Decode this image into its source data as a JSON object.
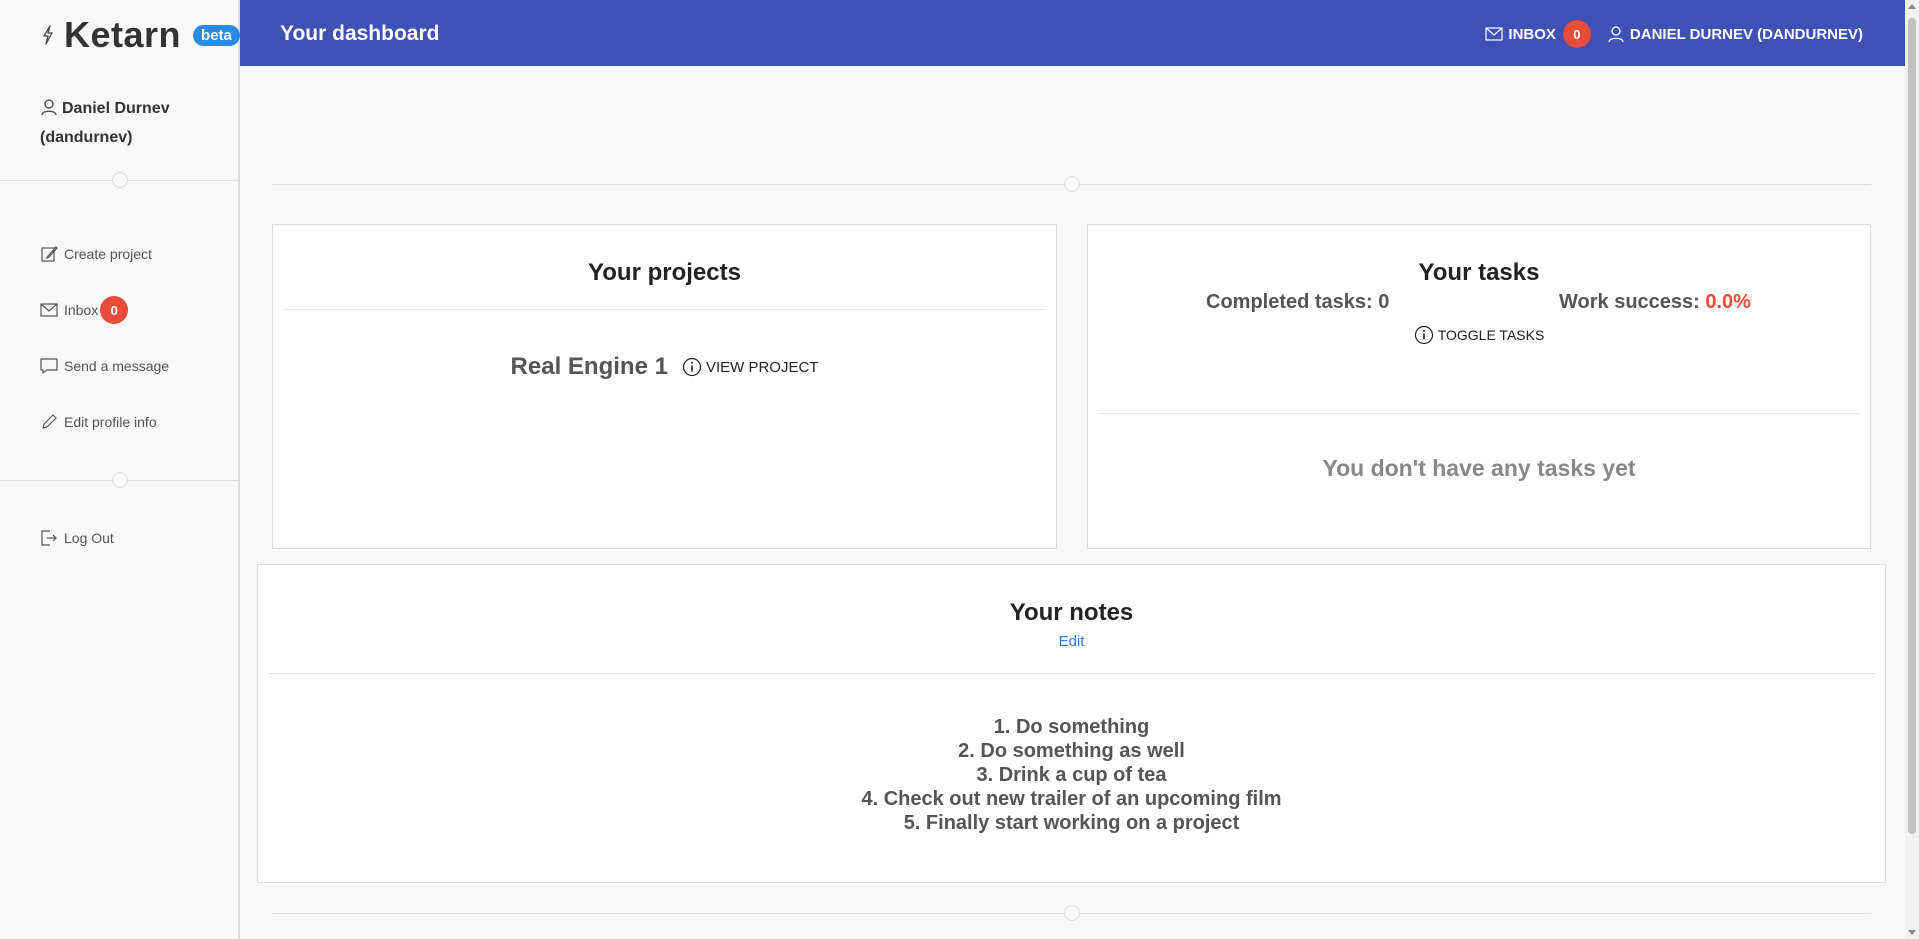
{
  "brand": {
    "name": "Ketarn",
    "badge": "beta"
  },
  "sidebar": {
    "user": "Daniel Durnev (dandurnev)",
    "items": [
      {
        "label": "Create project",
        "icon": "edit-icon"
      },
      {
        "label": "Inbox",
        "icon": "mail-icon",
        "badge": "0"
      },
      {
        "label": "Send a message",
        "icon": "chat-icon"
      },
      {
        "label": "Edit profile info",
        "icon": "pencil-icon"
      }
    ],
    "logout": "Log Out"
  },
  "topbar": {
    "title": "Your dashboard",
    "inbox_label": "INBOX",
    "inbox_count": "0",
    "user_label": "DANIEL DURNEV (DANDURNEV)"
  },
  "projects": {
    "title": "Your projects",
    "project_name": "Real Engine 1",
    "view_label": "VIEW PROJECT"
  },
  "tasks": {
    "title": "Your tasks",
    "completed": "Completed tasks: 0",
    "success_label": "Work success:",
    "success_value": "0.0%",
    "toggle_label": "TOGGLE TASKS",
    "empty": "You don't have any tasks yet"
  },
  "notes": {
    "title": "Your notes",
    "edit_label": "Edit",
    "items": [
      "1. Do something",
      "2. Do something as well",
      "3. Drink a cup of tea",
      "4. Check out new trailer of an upcoming film",
      "5. Finally start working on a project"
    ]
  },
  "colors": {
    "topbar": "#3f51b5",
    "badge": "#e74c3c",
    "beta": "#2b8ce6",
    "link": "#2b7bd6"
  }
}
